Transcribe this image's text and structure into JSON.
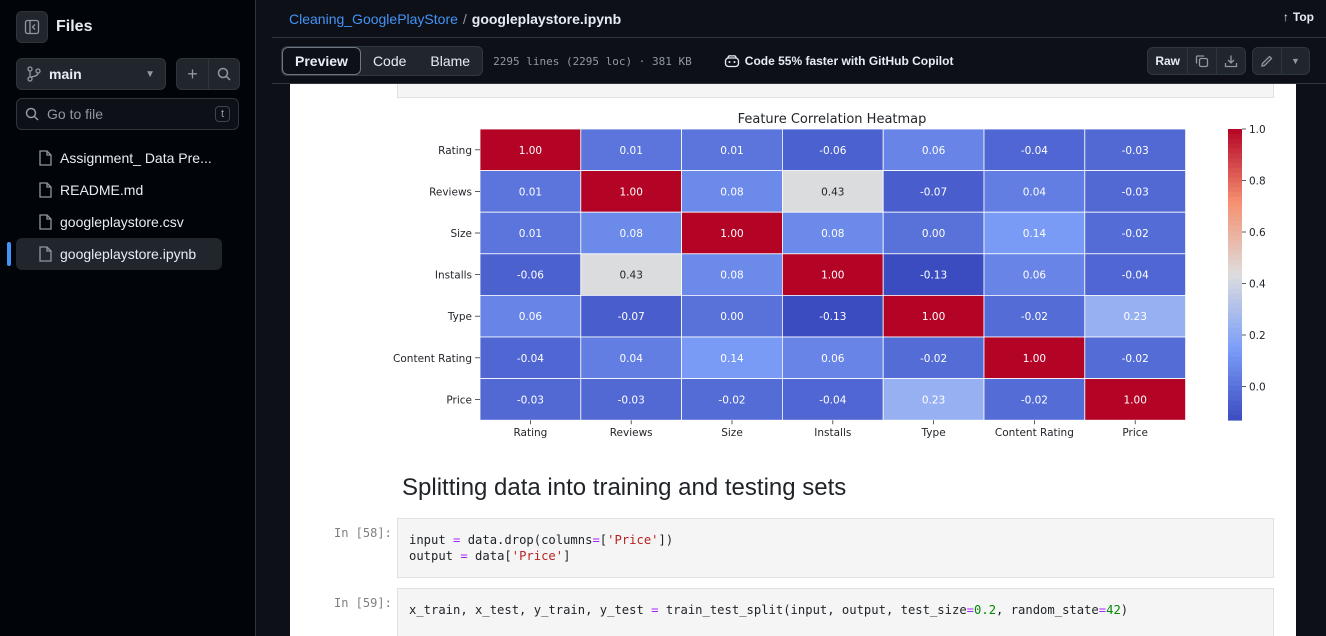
{
  "sidebar": {
    "title": "Files",
    "branch": "main",
    "goto_placeholder": "Go to file",
    "goto_shortcut": "t",
    "items": [
      {
        "label": "Assignment_ Data Pre..."
      },
      {
        "label": "README.md"
      },
      {
        "label": "googleplaystore.csv"
      },
      {
        "label": "googleplaystore.ipynb"
      }
    ]
  },
  "header": {
    "repo": "Cleaning_GooglePlayStore",
    "separator": "/",
    "file": "googleplaystore.ipynb",
    "top_label": "Top"
  },
  "toolbar": {
    "tabs": [
      "Preview",
      "Code",
      "Blame"
    ],
    "active_tab": "Preview",
    "meta": "2295 lines (2295 loc) · 381 KB",
    "copilot": "Code 55% faster with GitHub Copilot",
    "raw_label": "Raw"
  },
  "chart_data": {
    "type": "heatmap",
    "title": "Feature Correlation Heatmap",
    "labels": [
      "Rating",
      "Reviews",
      "Size",
      "Installs",
      "Type",
      "Content Rating",
      "Price"
    ],
    "matrix": [
      [
        1.0,
        0.01,
        0.01,
        -0.06,
        0.06,
        -0.04,
        -0.03
      ],
      [
        0.01,
        1.0,
        0.08,
        0.43,
        -0.07,
        0.04,
        -0.03
      ],
      [
        0.01,
        0.08,
        1.0,
        0.08,
        -0.0,
        0.14,
        -0.02
      ],
      [
        -0.06,
        0.43,
        0.08,
        1.0,
        -0.13,
        0.06,
        -0.04
      ],
      [
        0.06,
        -0.07,
        -0.0,
        -0.13,
        1.0,
        -0.02,
        0.23
      ],
      [
        -0.04,
        0.04,
        0.14,
        0.06,
        -0.02,
        1.0,
        -0.02
      ],
      [
        -0.03,
        -0.03,
        -0.02,
        -0.04,
        0.23,
        -0.02,
        1.0
      ]
    ],
    "colormap": "coolwarm",
    "vmin": -0.13,
    "vmax": 1.0,
    "colorbar_ticks": [
      "1.0",
      "0.8",
      "0.6",
      "0.4",
      "0.2",
      "0.0"
    ],
    "colorbar_tick_values": [
      1.0,
      0.8,
      0.6,
      0.4,
      0.2,
      0.0
    ]
  },
  "notebook": {
    "heading": "Splitting data into training and testing sets",
    "cells": [
      {
        "prompt": "In [58]:",
        "lines": [
          "input = data.drop(columns=['Price'])",
          "output = data['Price']"
        ]
      },
      {
        "prompt": "In [59]:",
        "lines": [
          "x_train, x_test, y_train, y_test = train_test_split(input, output, test_size=0.2, random_state=42)"
        ]
      }
    ]
  }
}
